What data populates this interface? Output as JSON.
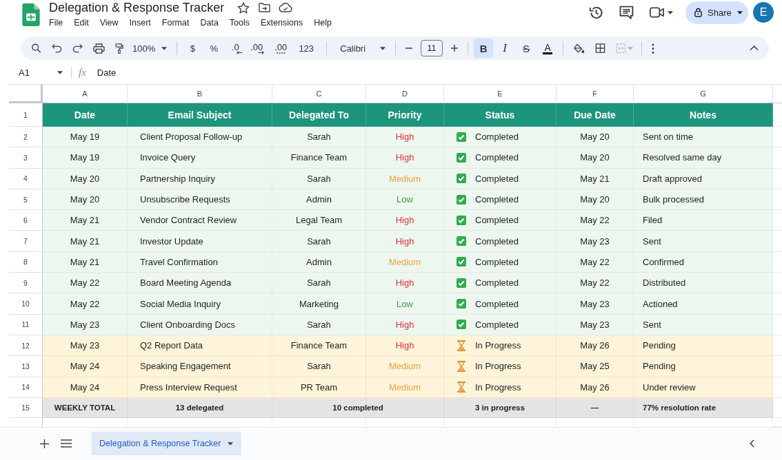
{
  "app": {
    "title": "Delegation & Response Tracker",
    "menu": [
      "File",
      "Edit",
      "View",
      "Insert",
      "Format",
      "Data",
      "Tools",
      "Extensions",
      "Help"
    ],
    "share_label": "Share",
    "avatar_initial": "E"
  },
  "toolbar": {
    "zoom": "100%",
    "format_buttons": [
      {
        "label": "$",
        "kind": "plain"
      },
      {
        "label": "%",
        "kind": "plain"
      },
      {
        "label": ".0",
        "kind": "arrow-left"
      },
      {
        "label": ".00",
        "kind": "arrow-right"
      },
      {
        "label": ".00",
        "kind": "underlined"
      },
      {
        "label": "123",
        "kind": "plain"
      }
    ],
    "font": "Calibri",
    "font_size": "11",
    "style_buttons": [
      {
        "label": "B",
        "kind": "bold",
        "selected": true
      },
      {
        "label": "I",
        "kind": "italic",
        "selected": false
      },
      {
        "label": "S",
        "kind": "strike",
        "selected": false
      },
      {
        "label": "A",
        "kind": "color",
        "selected": false
      }
    ]
  },
  "formula_bar": {
    "cell_ref": "A1",
    "function_label": "fx",
    "content": "Date"
  },
  "sheet": {
    "columns": [
      "A",
      "B",
      "C",
      "D",
      "E",
      "F",
      "G"
    ],
    "header_row": {
      "number": "1",
      "cells": [
        "Date",
        "Email Subject",
        "Delegated To",
        "Priority",
        "Status",
        "Due Date",
        "Notes"
      ]
    },
    "rows": [
      {
        "number": "2",
        "kind": "completed",
        "date": "May 19",
        "subject": "Client Proposal Follow-up",
        "delegated_to": "Sarah",
        "priority": {
          "text": "High",
          "color": "#e0313c"
        },
        "status": "Completed",
        "due_date": "May 20",
        "notes": "Sent on time"
      },
      {
        "number": "3",
        "kind": "completed",
        "date": "May 19",
        "subject": "Invoice Query",
        "delegated_to": "Finance Team",
        "priority": {
          "text": "High",
          "color": "#e0313c"
        },
        "status": "Completed",
        "due_date": "May 20",
        "notes": "Resolved same day"
      },
      {
        "number": "4",
        "kind": "completed",
        "date": "May 20",
        "subject": "Partnership Inquiry",
        "delegated_to": "Sarah",
        "priority": {
          "text": "Medium",
          "color": "#eba042"
        },
        "status": "Completed",
        "due_date": "May 21",
        "notes": "Draft approved"
      },
      {
        "number": "5",
        "kind": "completed",
        "date": "May 20",
        "subject": "Unsubscribe Requests",
        "delegated_to": "Admin",
        "priority": {
          "text": "Low",
          "color": "#3c9a45"
        },
        "status": "Completed",
        "due_date": "May 20",
        "notes": "Bulk processed"
      },
      {
        "number": "6",
        "kind": "completed",
        "date": "May 21",
        "subject": "Vendor Contract Review",
        "delegated_to": "Legal Team",
        "priority": {
          "text": "High",
          "color": "#e0313c"
        },
        "status": "Completed",
        "due_date": "May 22",
        "notes": "Filed"
      },
      {
        "number": "7",
        "kind": "completed",
        "date": "May 21",
        "subject": "Investor Update",
        "delegated_to": "Sarah",
        "priority": {
          "text": "High",
          "color": "#e0313c"
        },
        "status": "Completed",
        "due_date": "May 23",
        "notes": "Sent"
      },
      {
        "number": "8",
        "kind": "completed",
        "date": "May 21",
        "subject": "Travel Confirmation",
        "delegated_to": "Admin",
        "priority": {
          "text": "Medium",
          "color": "#eba042"
        },
        "status": "Completed",
        "due_date": "May 22",
        "notes": "Confirmed"
      },
      {
        "number": "9",
        "kind": "completed",
        "date": "May 22",
        "subject": "Board Meeting Agenda",
        "delegated_to": "Sarah",
        "priority": {
          "text": "High",
          "color": "#e0313c"
        },
        "status": "Completed",
        "due_date": "May 22",
        "notes": "Distributed"
      },
      {
        "number": "10",
        "kind": "completed",
        "date": "May 22",
        "subject": "Social Media Inquiry",
        "delegated_to": "Marketing",
        "priority": {
          "text": "Low",
          "color": "#3c9a45"
        },
        "status": "Completed",
        "due_date": "May 23",
        "notes": "Actioned"
      },
      {
        "number": "11",
        "kind": "completed",
        "date": "May 23",
        "subject": "Client Onboarding Docs",
        "delegated_to": "Sarah",
        "priority": {
          "text": "High",
          "color": "#e0313c"
        },
        "status": "Completed",
        "due_date": "May 23",
        "notes": "Sent"
      },
      {
        "number": "12",
        "kind": "in_progress",
        "date": "May 23",
        "subject": "Q2 Report Data",
        "delegated_to": "Finance Team",
        "priority": {
          "text": "High",
          "color": "#e0313c"
        },
        "status": "In Progress",
        "due_date": "May 26",
        "notes": "Pending"
      },
      {
        "number": "13",
        "kind": "in_progress",
        "date": "May 24",
        "subject": "Speaking Engagement",
        "delegated_to": "Sarah",
        "priority": {
          "text": "Medium",
          "color": "#eba042"
        },
        "status": "In Progress",
        "due_date": "May 25",
        "notes": "Pending"
      },
      {
        "number": "14",
        "kind": "in_progress",
        "date": "May 24",
        "subject": "Press Interview Request",
        "delegated_to": "PR Team",
        "priority": {
          "text": "Medium",
          "color": "#eba042"
        },
        "status": "In Progress",
        "due_date": "May 26",
        "notes": "Under review"
      }
    ],
    "total_row": {
      "number": "15",
      "cells": [
        {
          "text": "WEEKLY TOTAL",
          "merged": false
        },
        {
          "text": "13 delegated",
          "merged": false
        },
        {
          "text": "10 completed",
          "merged": true
        },
        {
          "text": "3 in progress",
          "merged": false
        },
        {
          "text": "—",
          "merged": false
        },
        {
          "text": "77% resolution rate",
          "merged": false
        }
      ]
    }
  },
  "sheet_tabs": [
    {
      "label": "Delegation & Response Tracker",
      "selected": true
    }
  ]
}
